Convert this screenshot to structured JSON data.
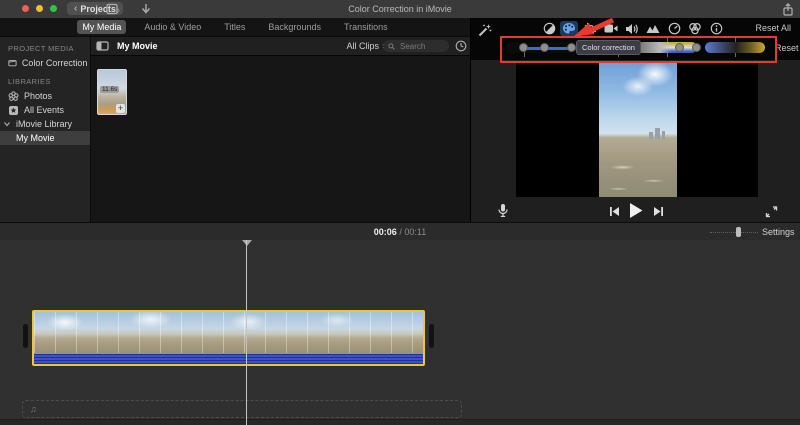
{
  "titlebar": {
    "title": "Color Correction in iMovie",
    "back_chevron": "‹",
    "projects_button": "Projects"
  },
  "tabs": {
    "items": [
      {
        "label": "My Media",
        "selected": true
      },
      {
        "label": "Audio & Video",
        "selected": false
      },
      {
        "label": "Titles",
        "selected": false
      },
      {
        "label": "Backgrounds",
        "selected": false
      },
      {
        "label": "Transitions",
        "selected": false
      }
    ]
  },
  "sidebar": {
    "project_media_header": "PROJECT MEDIA",
    "project_item": "Color Correction in…",
    "libraries_header": "LIBRARIES",
    "photos": "Photos",
    "all_events": "All Events",
    "imovie_library": "iMovie Library",
    "my_movie": "My Movie"
  },
  "media_browser": {
    "title": "My Movie",
    "filter_label": "All Clips",
    "search_placeholder": "Search",
    "clip_duration": "11.6s",
    "add_label": "+"
  },
  "inspector": {
    "tools": [
      "enhance-wand",
      "color-balance",
      "color-correction",
      "crop",
      "stabilization",
      "volume",
      "noise-reduction",
      "speed",
      "clip-filter",
      "info"
    ],
    "selected_tool": "color-correction",
    "tooltip": "Color correction",
    "reset_all_label": "Reset All",
    "reset_label": "Reset",
    "accent_blue": "#6aa2e8",
    "annotation_red": "#e8392f",
    "music_note": "♫"
  },
  "timeline": {
    "current_time": "00:06",
    "separator": "/",
    "total_time": "00:11",
    "settings_label": "Settings"
  }
}
